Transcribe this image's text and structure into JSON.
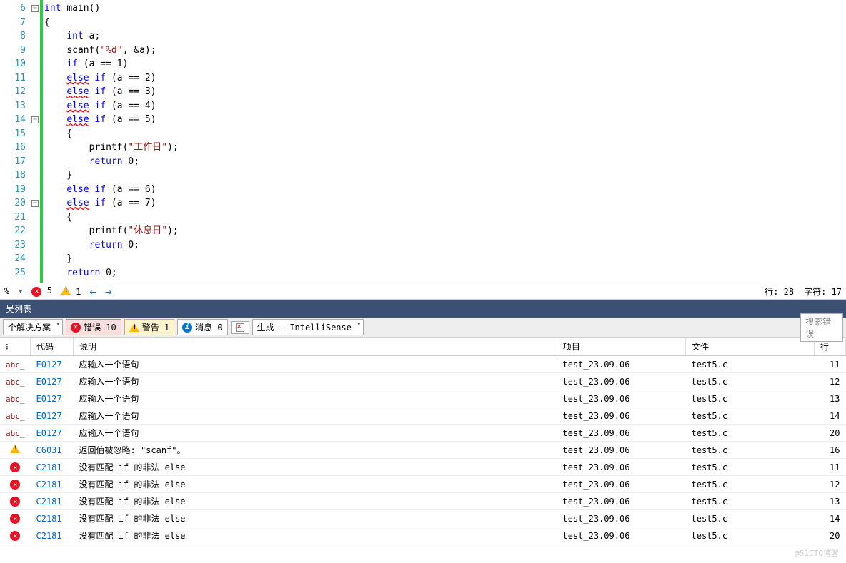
{
  "editor": {
    "line_start": 6,
    "lines": [
      {
        "n": 6,
        "fold": "minus",
        "html": "<span class='type'>int</span> <span class='func'>main</span>()"
      },
      {
        "n": 7,
        "html": "{"
      },
      {
        "n": 8,
        "html": "    <span class='type'>int</span> a;"
      },
      {
        "n": 9,
        "html": "    <span class='func'>scanf</span>(<span class='str'>\"%d\"</span>, &a);"
      },
      {
        "n": 10,
        "html": "    <span class='kw'>if</span> (a == 1)"
      },
      {
        "n": 11,
        "html": "    <span class='kw squig'>else</span> <span class='kw'>if</span> (a == 2)"
      },
      {
        "n": 12,
        "html": "    <span class='kw squig'>else</span> <span class='kw'>if</span> (a == 3)"
      },
      {
        "n": 13,
        "html": "    <span class='kw squig'>else</span> <span class='kw'>if</span> (a == 4)"
      },
      {
        "n": 14,
        "fold": "minus",
        "html": "    <span class='kw squig'>else</span> <span class='kw'>if</span> (a == 5)"
      },
      {
        "n": 15,
        "html": "    {"
      },
      {
        "n": 16,
        "html": "        <span class='func'>printf</span>(<span class='str'>\"工作日\"</span>);"
      },
      {
        "n": 17,
        "html": "        <span class='kw'>return</span> 0;"
      },
      {
        "n": 18,
        "html": "    }"
      },
      {
        "n": 19,
        "html": "    <span class='kw'>else</span> <span class='kw'>if</span> (a == 6)"
      },
      {
        "n": 20,
        "fold": "minus",
        "html": "    <span class='kw squig'>else</span> <span class='kw'>if</span> (a == 7)"
      },
      {
        "n": 21,
        "html": "    {"
      },
      {
        "n": 22,
        "html": "        <span class='func'>printf</span>(<span class='str'>\"休息日\"</span>);"
      },
      {
        "n": 23,
        "html": "        <span class='kw'>return</span> 0;"
      },
      {
        "n": 24,
        "html": "    }"
      },
      {
        "n": 25,
        "html": "    <span class='kw'>return</span> 0;"
      }
    ]
  },
  "status": {
    "zoom": "%",
    "err_count": "5",
    "warn_count": "1",
    "line_label": "行: 28",
    "char_label": "字符: 17"
  },
  "panel": {
    "title": "吴列表",
    "scope": "个解决方案",
    "errors_btn": "错误 10",
    "warnings_btn": "警告 1",
    "messages_btn": "消息 0",
    "build_mode": "生成 + IntelliSense",
    "search_placeholder": "搜索错误"
  },
  "columns": {
    "code": "代码",
    "desc": "说明",
    "project": "项目",
    "file": "文件",
    "line": "行"
  },
  "errors": [
    {
      "icon": "intelli",
      "code": "E0127",
      "desc": "应输入一个语句",
      "project": "test_23.09.06",
      "file": "test5.c",
      "line": "11"
    },
    {
      "icon": "intelli",
      "code": "E0127",
      "desc": "应输入一个语句",
      "project": "test_23.09.06",
      "file": "test5.c",
      "line": "12"
    },
    {
      "icon": "intelli",
      "code": "E0127",
      "desc": "应输入一个语句",
      "project": "test_23.09.06",
      "file": "test5.c",
      "line": "13"
    },
    {
      "icon": "intelli",
      "code": "E0127",
      "desc": "应输入一个语句",
      "project": "test_23.09.06",
      "file": "test5.c",
      "line": "14"
    },
    {
      "icon": "intelli",
      "code": "E0127",
      "desc": "应输入一个语句",
      "project": "test_23.09.06",
      "file": "test5.c",
      "line": "20"
    },
    {
      "icon": "warn",
      "code": "C6031",
      "desc": "返回值被忽略: \"scanf\"。",
      "project": "test_23.09.06",
      "file": "test5.c",
      "line": "16"
    },
    {
      "icon": "err",
      "code": "C2181",
      "desc": "没有匹配 if 的非法 else",
      "project": "test_23.09.06",
      "file": "test5.c",
      "line": "11"
    },
    {
      "icon": "err",
      "code": "C2181",
      "desc": "没有匹配 if 的非法 else",
      "project": "test_23.09.06",
      "file": "test5.c",
      "line": "12"
    },
    {
      "icon": "err",
      "code": "C2181",
      "desc": "没有匹配 if 的非法 else",
      "project": "test_23.09.06",
      "file": "test5.c",
      "line": "13"
    },
    {
      "icon": "err",
      "code": "C2181",
      "desc": "没有匹配 if 的非法 else",
      "project": "test_23.09.06",
      "file": "test5.c",
      "line": "14"
    },
    {
      "icon": "err",
      "code": "C2181",
      "desc": "没有匹配 if 的非法 else",
      "project": "test_23.09.06",
      "file": "test5.c",
      "line": "20"
    }
  ],
  "watermark": "@51CTO博客"
}
